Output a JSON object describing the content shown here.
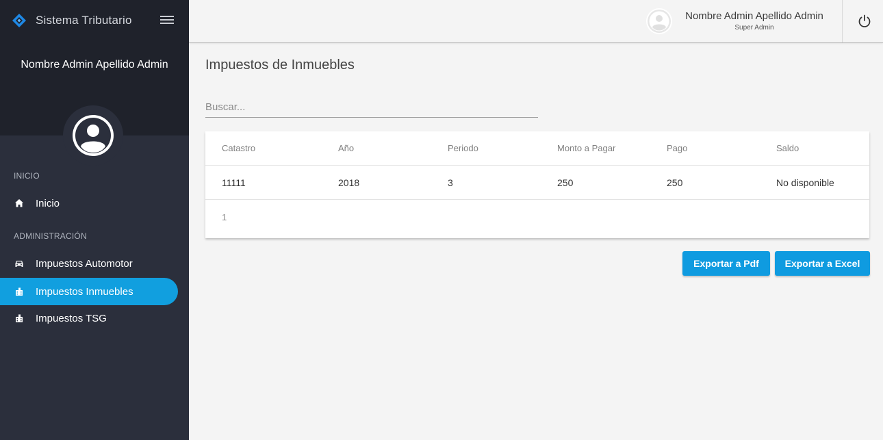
{
  "app": {
    "name": "Sistema Tributario",
    "brand_color": "#1e88e5",
    "accent_color": "#119fdf"
  },
  "sidebar": {
    "username": "Nombre Admin Apellido Admin",
    "sections": [
      {
        "title": "INICIO",
        "items": [
          {
            "label": "Inicio",
            "icon": "home-icon",
            "active": false
          }
        ]
      },
      {
        "title": "ADMINISTRACIÓN",
        "items": [
          {
            "label": "Impuestos Automotor",
            "icon": "car-icon",
            "active": false
          },
          {
            "label": "Impuestos Inmuebles",
            "icon": "building-icon",
            "active": true
          },
          {
            "label": "Impuestos TSG",
            "icon": "building-icon",
            "active": false
          }
        ]
      }
    ]
  },
  "header": {
    "user_name": "Nombre Admin Apellido Admin",
    "user_role": "Super Admin",
    "power_icon": "power-icon"
  },
  "main": {
    "title": "Impuestos de Inmuebles",
    "search_placeholder": "Buscar...",
    "search_value": "",
    "table": {
      "columns": [
        "Catastro",
        "Año",
        "Periodo",
        "Monto a Pagar",
        "Pago",
        "Saldo"
      ],
      "rows": [
        [
          "11111",
          "2018",
          "3",
          "250",
          "250",
          "No disponible"
        ]
      ],
      "page": "1"
    },
    "buttons": {
      "export_pdf": "Exportar a Pdf",
      "export_excel": "Exportar a Excel"
    }
  }
}
